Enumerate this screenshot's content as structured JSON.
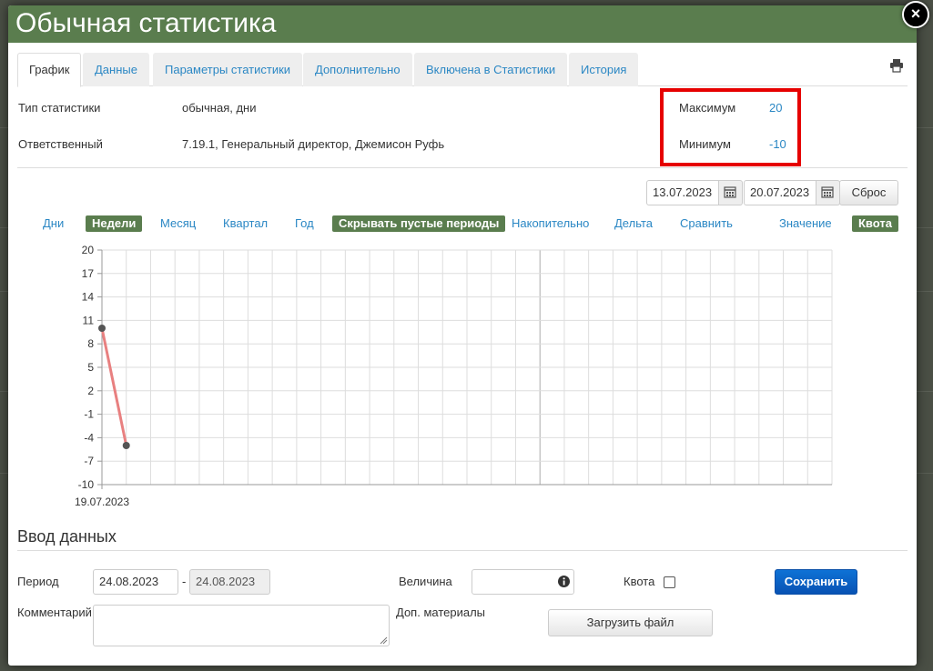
{
  "window": {
    "title": "Обычная статистика",
    "close_label": "×"
  },
  "tabs": [
    {
      "label": "График",
      "active": true
    },
    {
      "label": "Данные"
    },
    {
      "label": "Параметры статистики"
    },
    {
      "label": "Дополнительно"
    },
    {
      "label": "Включена в Статистики"
    },
    {
      "label": "История"
    }
  ],
  "info": {
    "type_label": "Тип статистики",
    "type_value": "обычная, дни",
    "responsible_label": "Ответственный",
    "responsible_value": "7.19.1, Генеральный директор, Джемисон Руфь",
    "max_label": "Максимум",
    "max_value": "20",
    "min_label": "Минимум",
    "min_value": "-10"
  },
  "date_range": {
    "from": "13.07.2023",
    "to": "20.07.2023",
    "reset_label": "Сброс"
  },
  "filters": {
    "days": "Дни",
    "weeks": "Недели",
    "month": "Месяц",
    "quarter": "Квартал",
    "year": "Год",
    "hide_empty": "Скрывать пустые периоды",
    "cumulative": "Накопительно",
    "delta": "Дельта",
    "compare": "Сравнить",
    "value": "Значение",
    "quota": "Квота"
  },
  "chart_data": {
    "type": "line",
    "ylim": [
      -10,
      20
    ],
    "y_ticks": [
      "20",
      "17",
      "14",
      "11",
      "8",
      "5",
      "2",
      "-1",
      "-4",
      "-7",
      "-10"
    ],
    "x_label": "19.07.2023",
    "series": [
      {
        "values": [
          10,
          -5
        ]
      }
    ],
    "grid": true,
    "colors": {
      "line": "#e88080",
      "point": "#555555"
    }
  },
  "entry": {
    "title": "Ввод данных",
    "period_label": "Период",
    "period_from": "24.08.2023",
    "period_sep": "-",
    "period_to": "24.08.2023",
    "value_label": "Величина",
    "quota_label": "Квота",
    "save_label": "Сохранить",
    "comment_label": "Комментарий",
    "materials_label": "Доп. материалы",
    "upload_label": "Загрузить файл"
  }
}
